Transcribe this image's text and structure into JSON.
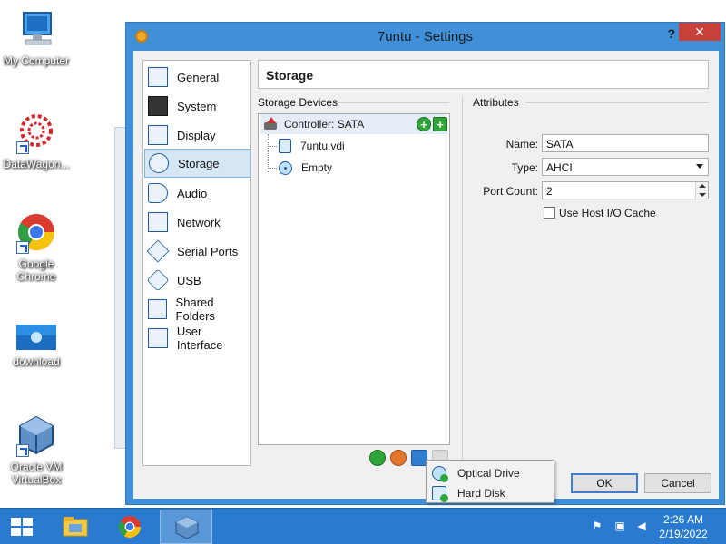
{
  "desktop": {
    "icons": [
      {
        "label": "My Computer"
      },
      {
        "label": "DataWagon..."
      },
      {
        "label": "Google Chrome"
      },
      {
        "label": "download"
      },
      {
        "label": "Oracle VM VirtualBox"
      }
    ]
  },
  "dialog": {
    "title": "7untu - Settings",
    "help_label": "?",
    "close_label": "✕",
    "nav": [
      {
        "label": "General"
      },
      {
        "label": "System"
      },
      {
        "label": "Display"
      },
      {
        "label": "Storage",
        "selected": true
      },
      {
        "label": "Audio"
      },
      {
        "label": "Network"
      },
      {
        "label": "Serial Ports"
      },
      {
        "label": "USB"
      },
      {
        "label": "Shared Folders"
      },
      {
        "label": "User Interface"
      }
    ],
    "page_title": "Storage",
    "storage_devices_label": "Storage Devices",
    "attributes_label": "Attributes",
    "tree": {
      "controller": "Controller: SATA",
      "items": [
        {
          "label": "7untu.vdi",
          "icon": "hard-disk-icon"
        },
        {
          "label": "Empty",
          "icon": "optical-disc-icon"
        }
      ]
    },
    "form": {
      "name_label": "Name:",
      "name_value": "SATA",
      "type_label": "Type:",
      "type_value": "AHCI",
      "port_count_label": "Port Count:",
      "port_count_value": "2",
      "host_io_cache_label": "Use Host I/O Cache",
      "host_io_cache_checked": false
    },
    "buttons": {
      "ok": "OK",
      "cancel": "Cancel"
    },
    "popup_menu": [
      {
        "label": "Optical Drive"
      },
      {
        "label": "Hard Disk"
      }
    ]
  },
  "taskbar": {
    "time": "2:26 AM",
    "date": "2/19/2022"
  },
  "colors": {
    "window_frame": "#3f90d9",
    "taskbar": "#2a7bcf",
    "selection": "#d5e6f5",
    "close_button": "#c7413a"
  }
}
